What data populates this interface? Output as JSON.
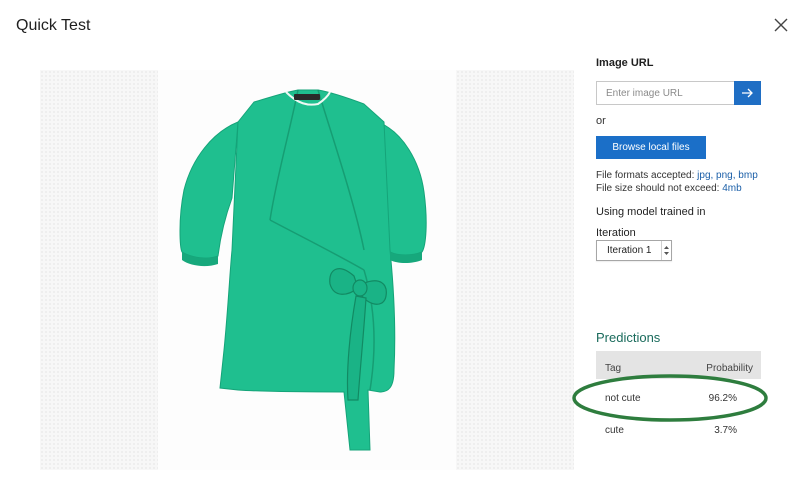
{
  "dialog": {
    "title": "Quick Test",
    "close_icon": "close-icon"
  },
  "image": {
    "description_icon": "green-wrap-blouse-image",
    "garment_color": "#1fbf8f"
  },
  "panel": {
    "image_url_label": "Image URL",
    "image_url_placeholder": "Enter image URL",
    "image_url_value": "",
    "go_icon": "arrow-right-icon",
    "or_text": "or",
    "browse_button_label": "Browse local files",
    "formats_prefix": "File formats accepted: ",
    "formats_value": "jpg, png, bmp",
    "size_prefix": "File size should not exceed: ",
    "size_value": "4mb",
    "model_label": "Using model trained in",
    "iteration_label": "Iteration",
    "iteration_selected": "Iteration 1"
  },
  "predictions": {
    "title": "Predictions",
    "columns": [
      "Tag",
      "Probability"
    ],
    "rows": [
      {
        "tag": "not cute",
        "probability": "96.2%"
      },
      {
        "tag": "cute",
        "probability": "3.7%"
      }
    ]
  },
  "colors": {
    "accent": "#1b6fc8",
    "predictions_title": "#1a6b5c",
    "annotation_ellipse": "#2e7d3e"
  }
}
